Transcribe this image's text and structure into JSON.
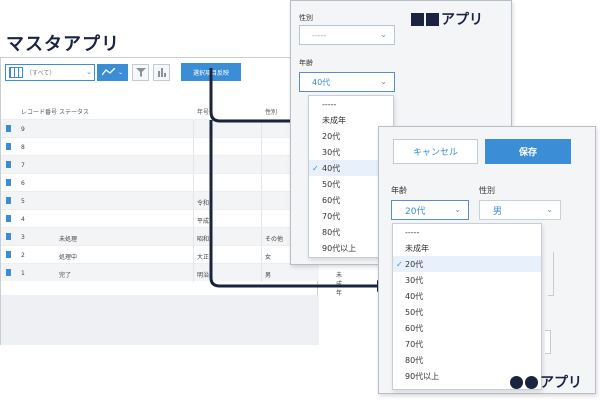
{
  "title": "マスタアプリ",
  "list_view": {
    "view_select_value": "（すべて）",
    "action_button_label": "選択項目反映",
    "columns": {
      "record_no": "レコード番号",
      "status": "ステータス",
      "era": "年号",
      "sex": "性別"
    },
    "rows": [
      {
        "no": "9",
        "status": "",
        "era": "",
        "sex": ""
      },
      {
        "no": "8",
        "status": "",
        "era": "",
        "sex": ""
      },
      {
        "no": "7",
        "status": "",
        "era": "",
        "sex": ""
      },
      {
        "no": "6",
        "status": "",
        "era": "",
        "sex": ""
      },
      {
        "no": "5",
        "status": "",
        "era": "令和",
        "sex": ""
      },
      {
        "no": "4",
        "status": "",
        "era": "平成",
        "sex": ""
      },
      {
        "no": "3",
        "status": "未処理",
        "era": "昭和",
        "sex": "その他"
      },
      {
        "no": "2",
        "status": "処理中",
        "era": "大正",
        "sex": "女"
      },
      {
        "no": "1",
        "status": "完了",
        "era": "明治",
        "sex": "男",
        "extra": "未成年"
      }
    ]
  },
  "app1": {
    "name": "アプリ",
    "sex_label": "性別",
    "sex_value": "-----",
    "age_label": "年齢",
    "age_value": "40代",
    "age_options": [
      "-----",
      "未成年",
      "20代",
      "30代",
      "40代",
      "50代",
      "60代",
      "70代",
      "80代",
      "90代以上"
    ],
    "age_selected": "40代"
  },
  "app2": {
    "name": "アプリ",
    "cancel_label": "キャンセル",
    "save_label": "保存",
    "age_label": "年齢",
    "age_value": "20代",
    "sex_label": "性別",
    "sex_value": "男",
    "age_options": [
      "-----",
      "未成年",
      "20代",
      "30代",
      "40代",
      "50代",
      "60代",
      "70代",
      "80代",
      "90代以上"
    ],
    "age_selected": "20代"
  },
  "colors": {
    "accent": "#3b8ed6",
    "brand_dark": "#1a2340",
    "selected_row": "#e8f1fb"
  },
  "icons": [
    "view-list-icon",
    "graph-icon",
    "filter-icon",
    "bar-chart-icon",
    "document-icon",
    "check-icon",
    "chevron-down-icon",
    "square-icon",
    "circle-icon"
  ]
}
